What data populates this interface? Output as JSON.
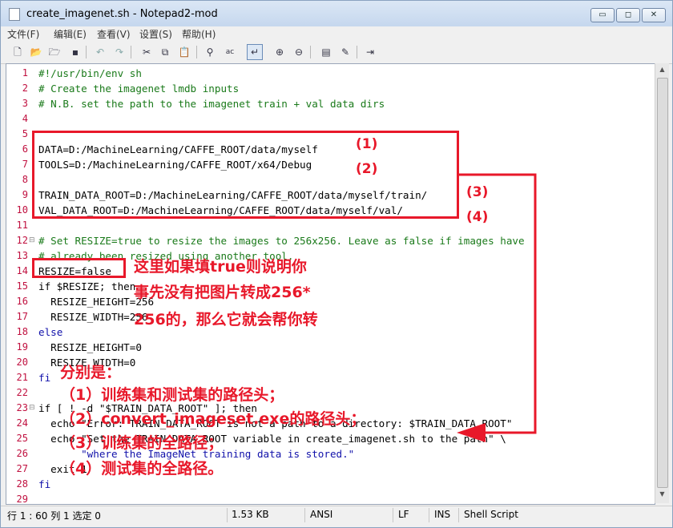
{
  "window": {
    "title": "create_imagenet.sh - Notepad2-mod",
    "controls": {
      "minimize": "▭",
      "maximize": "◻",
      "close": "✕"
    }
  },
  "menu": [
    "文件(F)",
    "编辑(E)",
    "查看(V)",
    "设置(S)",
    "帮助(H)"
  ],
  "toolbar_icons": [
    "new-file-icon",
    "open-folder-icon",
    "browse-icon",
    "save-icon",
    "undo-icon",
    "redo-icon",
    "cut-icon",
    "copy-icon",
    "paste-icon",
    "find-icon",
    "replace-icon",
    "word-wrap-icon",
    "zoom-in-icon",
    "zoom-out-icon",
    "scheme-icon",
    "customize-icon",
    "exit-icon"
  ],
  "editor": {
    "lines": [
      {
        "n": "1",
        "text": "#!/usr/bin/env sh",
        "style": "cm"
      },
      {
        "n": "2",
        "text": "# Create the imagenet lmdb inputs",
        "style": "cm"
      },
      {
        "n": "3",
        "text": "# N.B. set the path to the imagenet train + val data dirs",
        "style": "cm"
      },
      {
        "n": "4",
        "text": "",
        "style": ""
      },
      {
        "n": "5",
        "text": "",
        "style": ""
      },
      {
        "n": "6",
        "text": "DATA=D:/MachineLearning/CAFFE_ROOT/data/myself",
        "style": ""
      },
      {
        "n": "7",
        "text": "TOOLS=D:/MachineLearning/CAFFE_ROOT/x64/Debug",
        "style": ""
      },
      {
        "n": "8",
        "text": "",
        "style": ""
      },
      {
        "n": "9",
        "text": "TRAIN_DATA_ROOT=D:/MachineLearning/CAFFE_ROOT/data/myself/train/",
        "style": ""
      },
      {
        "n": "10",
        "text": "VAL_DATA_ROOT=D:/MachineLearning/CAFFE_ROOT/data/myself/val/",
        "style": ""
      },
      {
        "n": "11",
        "text": "",
        "style": ""
      },
      {
        "n": "12",
        "text": "# Set RESIZE=true to resize the images to 256x256. Leave as false if images have",
        "style": "cm"
      },
      {
        "n": "13",
        "text": "# already been resized using another tool.",
        "style": "cm"
      },
      {
        "n": "14",
        "text": "RESIZE=false",
        "style": ""
      },
      {
        "n": "15",
        "text": "if $RESIZE; then",
        "style": "kwline"
      },
      {
        "n": "16",
        "text": "  RESIZE_HEIGHT=256",
        "style": ""
      },
      {
        "n": "17",
        "text": "  RESIZE_WIDTH=256",
        "style": ""
      },
      {
        "n": "18",
        "text": "else",
        "style": "kw"
      },
      {
        "n": "19",
        "text": "  RESIZE_HEIGHT=0",
        "style": ""
      },
      {
        "n": "20",
        "text": "  RESIZE_WIDTH=0",
        "style": ""
      },
      {
        "n": "21",
        "text": "fi",
        "style": "kw"
      },
      {
        "n": "22",
        "text": "",
        "style": ""
      },
      {
        "n": "23",
        "text": "if [ ! -d \"$TRAIN_DATA_ROOT\" ]; then",
        "style": "kwline"
      },
      {
        "n": "24",
        "text": "  echo \"Error: TRAIN_DATA_ROOT is not a path to a directory: $TRAIN_DATA_ROOT\"",
        "style": "kwline"
      },
      {
        "n": "25",
        "text": "  echo \"Set the TRAIN_DATA_ROOT variable in create_imagenet.sh to the path\" \\",
        "style": "kwline"
      },
      {
        "n": "26",
        "text": "       \"where the ImageNet training data is stored.\"",
        "style": "str"
      },
      {
        "n": "27",
        "text": "  exit 1",
        "style": "kwline"
      },
      {
        "n": "28",
        "text": "fi",
        "style": "kw"
      },
      {
        "n": "29",
        "text": "",
        "style": ""
      }
    ]
  },
  "annotations": {
    "labels": [
      "(1)",
      "(2)",
      "(3)",
      "(4)"
    ],
    "resize_note": [
      "这里如果填true则说明你",
      "事先没有把图片转成256*",
      "256的，那么它就会帮你转"
    ],
    "list_title": "分别是：",
    "list": [
      "（1）训练集和测试集的路径头；",
      "（2）convert_imageset.exe的路径头；",
      "（3）训练集的全路径；",
      "（4）测试集的全路径。"
    ]
  },
  "statusbar": {
    "position": "行 1 : 60   列 1   选定 0",
    "size": "1.53 KB",
    "encoding": "ANSI",
    "eol": "LF",
    "mode": "INS",
    "scheme": "Shell Script"
  },
  "colors": {
    "accent_red": "#e8182a",
    "comment": "#1a7a1a",
    "line_number": "#c0103f"
  }
}
